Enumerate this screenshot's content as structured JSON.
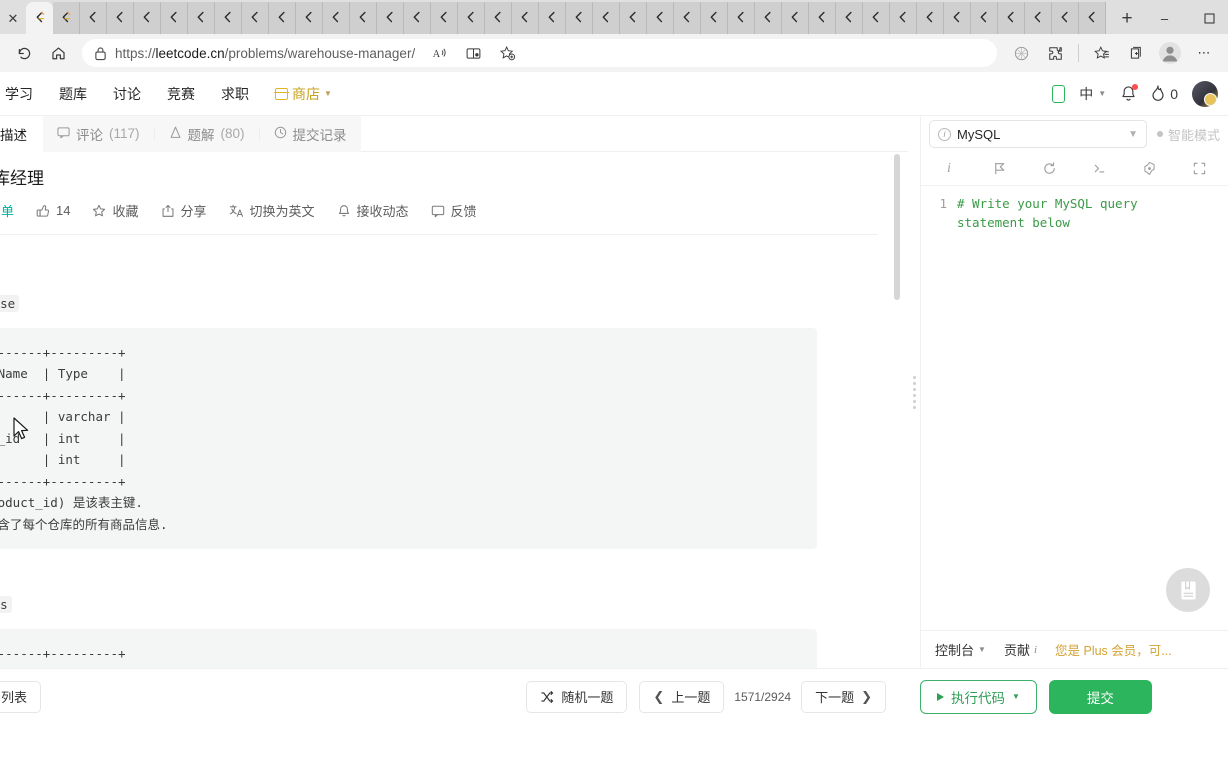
{
  "browser": {
    "tab_count": 40,
    "active_tab_index": 0,
    "tab_favicon": "leetcode-icon",
    "new_tab_label": "+",
    "window_controls": {
      "minimize": "–",
      "maximize": "❐",
      "close": "✕"
    },
    "url_scheme": "https://",
    "url_domain": "leetcode.cn",
    "url_path": "/problems/warehouse-manager/",
    "toolbar_icons": [
      "refresh-icon",
      "home-icon",
      "lock-icon",
      "read-aloud-icon",
      "immersive-reader-icon",
      "add-favorite-icon",
      "browser-essentials-icon",
      "extensions-icon",
      "favorites-icon",
      "collections-icon",
      "profile-icon",
      "settings-more-icon"
    ]
  },
  "site_nav": {
    "items": [
      {
        "label": "学习",
        "name": "study"
      },
      {
        "label": "题库",
        "name": "problemset"
      },
      {
        "label": "讨论",
        "name": "discuss"
      },
      {
        "label": "竞赛",
        "name": "contest"
      },
      {
        "label": "求职",
        "name": "jobs"
      },
      {
        "label": "商店",
        "name": "store"
      }
    ],
    "right": {
      "mobile_icon": "phone-icon",
      "language": "中",
      "notification_icon": "bell-icon",
      "streak_icon": "flame-icon",
      "streak_count": "0",
      "avatar": "user-avatar"
    }
  },
  "description_tabs": [
    {
      "label": "描述",
      "icon": "document-icon",
      "active": true
    },
    {
      "label": "评论",
      "count": "(117)",
      "icon": "comment-icon",
      "active": false
    },
    {
      "label": "题解",
      "count": "(80)",
      "icon": "flask-icon",
      "active": false
    },
    {
      "label": "提交记录",
      "icon": "clock-icon",
      "active": false
    }
  ],
  "problem": {
    "title": "仓库经理",
    "difficulty": "简单",
    "likes": "14",
    "actions": [
      {
        "label": "收藏",
        "icon": "star-icon"
      },
      {
        "label": "分享",
        "icon": "share-icon"
      },
      {
        "label": "切换为英文",
        "icon": "translate-icon"
      },
      {
        "label": "接收动态",
        "icon": "bell-outline-icon"
      },
      {
        "label": "反馈",
        "icon": "feedback-icon"
      }
    ],
    "intro_tail": ">",
    "table1_name": "ehouse",
    "table1_block": "-----------+---------+\nlumn Name  | Type    |\n-----------+---------+\ne          | varchar |\noduct_id   | int     |\nts         | int     |\n-----------+---------+",
    "table1_note1": "e, product_id) 是该表主键.",
    "table1_note2": "的行包含了每个仓库的所有商品信息.",
    "table2_name": "ducts",
    "table2_block": "-----------+---------+\nlumn Name  | Type    |\n-----------+---------+\noduct_id   | int     |\noduct_name | varchar |"
  },
  "editor": {
    "language": "MySQL",
    "language_icon": "info-circle-icon",
    "smart_mode": "智能模式",
    "toolbar_icons": [
      "info-icon",
      "flag-icon",
      "reset-icon",
      "terminal-icon",
      "settings-icon",
      "fullscreen-icon"
    ],
    "line_number": "1",
    "code_line": "# Write your MySQL query statement below",
    "note_fab": "notebook-icon",
    "console": {
      "console_label": "控制台",
      "contribute_label": "贡献",
      "plus_note": "您是 Plus 会员，可..."
    }
  },
  "footer": {
    "list_button": "目列表",
    "random_button": "随机一题",
    "prev_button": "上一题",
    "page_indicator": "1571/2924",
    "next_button": "下一题",
    "run_button": "执行代码",
    "submit_button": "提交"
  },
  "colors": {
    "accent_green": "#2db55d",
    "difficulty_easy": "#00af9b",
    "plus_gold": "#d4a335",
    "store_gold": "#c8a21c"
  }
}
